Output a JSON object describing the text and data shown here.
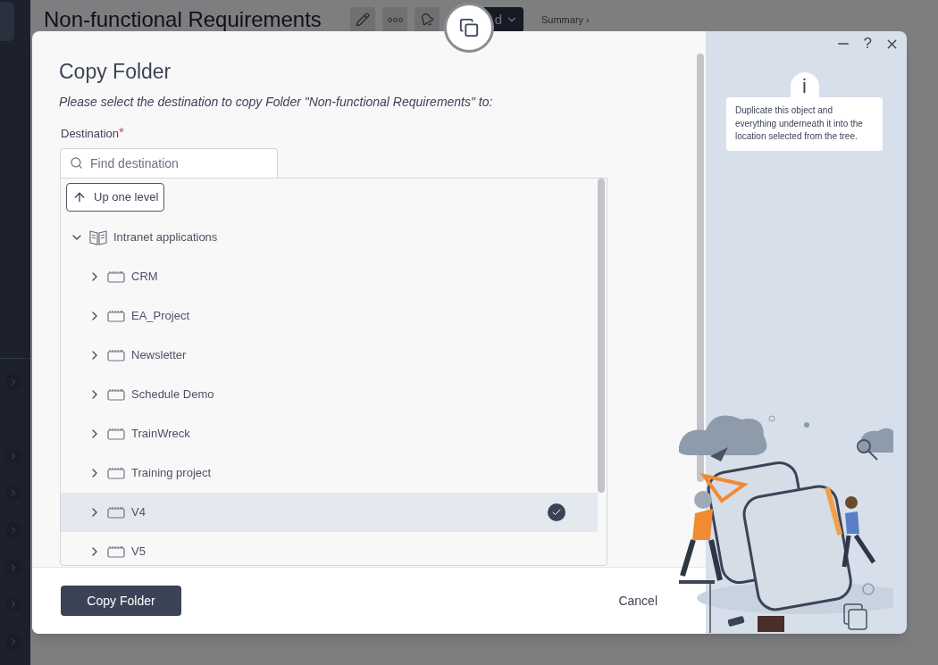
{
  "page": {
    "title": "Non-functional Requirements",
    "action_button": "d",
    "breadcrumb": "Summary ›"
  },
  "dialog": {
    "title": "Copy Folder",
    "subtitle": "Please select the destination to copy Folder \"Non-functional Requirements\" to:",
    "help_button": "?",
    "info_mark": "i",
    "help_text": "Duplicate this object and everything underneath it into the location selected from the tree.",
    "destination": {
      "label": "Destination",
      "required_mark": "*",
      "placeholder": "Find destination"
    },
    "up_button": "Up one level",
    "tree": [
      {
        "label": "Intranet applications",
        "kind": "book",
        "expanded": true,
        "selected": false,
        "children": [
          {
            "label": "CRM",
            "kind": "folder",
            "expanded": false,
            "selected": false
          },
          {
            "label": "EA_Project",
            "kind": "folder",
            "expanded": false,
            "selected": false
          },
          {
            "label": "Newsletter",
            "kind": "folder",
            "expanded": false,
            "selected": false
          },
          {
            "label": "Schedule Demo",
            "kind": "folder",
            "expanded": false,
            "selected": false
          },
          {
            "label": "TrainWreck",
            "kind": "folder",
            "expanded": false,
            "selected": false
          },
          {
            "label": "Training project",
            "kind": "folder",
            "expanded": false,
            "selected": false
          },
          {
            "label": "V4",
            "kind": "folder",
            "expanded": false,
            "selected": true
          },
          {
            "label": "V5",
            "kind": "folder",
            "expanded": false,
            "selected": false
          }
        ]
      }
    ],
    "primary_button": "Copy Folder",
    "cancel_button": "Cancel"
  }
}
